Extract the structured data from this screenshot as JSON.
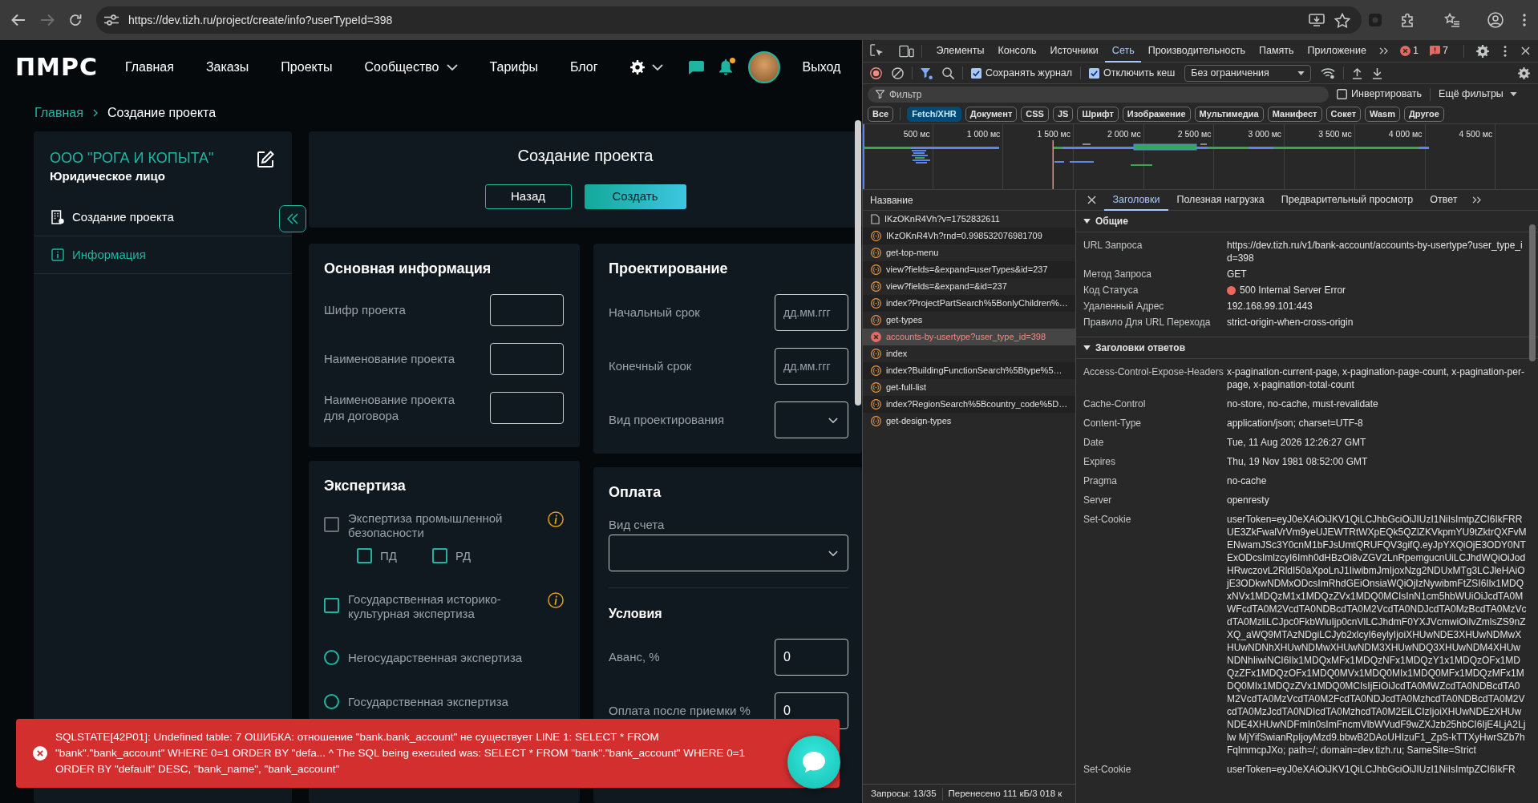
{
  "browser": {
    "url": "https://dev.tizh.ru/project/create/info?userTypeId=398"
  },
  "app": {
    "logo": "ПМРС",
    "nav": [
      {
        "label": "Главная",
        "kind": "link"
      },
      {
        "label": "Заказы",
        "kind": "link"
      },
      {
        "label": "Проекты",
        "kind": "link"
      },
      {
        "label": "Сообщество",
        "kind": "dropdown"
      },
      {
        "label": "Тарифы",
        "kind": "link"
      },
      {
        "label": "Блог",
        "kind": "link"
      }
    ],
    "has_unread_notifications": true,
    "logout": "Выход",
    "breadcrumb": [
      {
        "label": "Главная",
        "kind": "link"
      },
      {
        "label": "Создание проекта",
        "kind": "current"
      }
    ],
    "sidebar": {
      "org_name": "ООО \"РОГА И КОПЫТА\"",
      "org_type": "Юридическое лицо",
      "items": [
        {
          "label": "Создание проекта",
          "selected": false
        },
        {
          "label": "Информация",
          "selected": true
        }
      ]
    },
    "header": {
      "title": "Создание проекта",
      "buttons": [
        {
          "label": "Назад",
          "kind": "back"
        },
        {
          "label": "Создать",
          "kind": "submit"
        }
      ]
    },
    "main_info": {
      "title": "Основная информация",
      "fields": [
        {
          "label": "Шифр проекта",
          "kind": "text"
        },
        {
          "label": "Наименование проекта",
          "kind": "text"
        },
        {
          "label": "Наименование проекта для договора",
          "kind": "text"
        }
      ]
    },
    "design": {
      "title": "Проектирование",
      "fields": [
        {
          "label": "Начальный срок",
          "kind": "date",
          "placeholder": "дд.мм.ггг"
        },
        {
          "label": "Конечный срок",
          "kind": "date",
          "placeholder": "дд.мм.ггг"
        },
        {
          "label": "Вид проектирования",
          "kind": "select"
        }
      ]
    },
    "expertise": {
      "title": "Экспертиза",
      "options": [
        {
          "kind": "checkbox",
          "label": "Экспертиза промышленной безопасности",
          "checked": false,
          "disabled": true,
          "info": true,
          "children": [
            {
              "label": "ПД",
              "checked": false,
              "disabled": false
            },
            {
              "label": "РД",
              "checked": false,
              "disabled": false
            }
          ]
        },
        {
          "kind": "checkbox",
          "label": "Государственная историко-культурная экспертиза",
          "checked": false,
          "disabled": false,
          "info": true
        },
        {
          "kind": "radio",
          "label": "Негосударственная экспертиза",
          "selected": false,
          "info": false
        },
        {
          "kind": "radio",
          "label": "Государственная экспертиза",
          "selected": false,
          "info": false
        }
      ]
    },
    "payment": {
      "title": "Оплата",
      "account_label": "Вид счета",
      "terms_title": "Условия",
      "terms": [
        {
          "label": "Аванс, %",
          "value": "0"
        },
        {
          "label": "Оплата после приемки %",
          "value": "0"
        }
      ]
    },
    "toast": {
      "kind": "error",
      "message": "SQLSTATE[42P01]: Undefined table: 7 ОШИБКА: отношение \"bank.bank_account\" не существует LINE 1: SELECT * FROM \"bank\".\"bank_account\" WHERE 0=1 ORDER BY \"defa... ^ The SQL being executed was: SELECT * FROM \"bank\".\"bank_account\" WHERE 0=1 ORDER BY \"default\" DESC, \"bank_name\", \"bank_account\""
    }
  },
  "devtools": {
    "tabs": [
      {
        "label": "Элементы",
        "selected": false
      },
      {
        "label": "Консоль",
        "selected": false
      },
      {
        "label": "Источники",
        "selected": false
      },
      {
        "label": "Сеть",
        "selected": true
      },
      {
        "label": "Производительность",
        "selected": false
      },
      {
        "label": "Память",
        "selected": false
      },
      {
        "label": "Приложение",
        "selected": false
      }
    ],
    "errors": "1",
    "issues": "7",
    "recording": true,
    "preserve_log": {
      "label": "Сохранять журнал",
      "checked": true
    },
    "disable_cache": {
      "label": "Отключить кеш",
      "checked": true
    },
    "throttling": "Без ограничения",
    "filter_placeholder": "Фильтр",
    "invert": {
      "label": "Инвертировать",
      "checked": false
    },
    "more_filters": "Ещё фильтры",
    "type_filters": [
      {
        "label": "Все",
        "selected": false
      },
      {
        "label": "Fetch/XHR",
        "selected": true
      },
      {
        "label": "Документ",
        "selected": false
      },
      {
        "label": "CSS",
        "selected": false
      },
      {
        "label": "JS",
        "selected": false
      },
      {
        "label": "Шрифт",
        "selected": false
      },
      {
        "label": "Изображение",
        "selected": false
      },
      {
        "label": "Мультимедиа",
        "selected": false
      },
      {
        "label": "Манифест",
        "selected": false
      },
      {
        "label": "Сокет",
        "selected": false
      },
      {
        "label": "Wasm",
        "selected": false
      },
      {
        "label": "Другое",
        "selected": false
      }
    ],
    "overview_ticks": [
      "500 мс",
      "1 000 мс",
      "1 500 мс",
      "2 000 мс",
      "2 500 мс",
      "3 000 мс",
      "3 500 мс",
      "4 000 мс",
      "4 500 мс"
    ],
    "name_column": "Название",
    "requests": [
      {
        "name": "IKzOKnR4Vh?v=1752832611",
        "kind": "document",
        "failed": false,
        "selected": false
      },
      {
        "name": "IKzOKnR4Vh?rnd=0.998532076981709",
        "kind": "fetch",
        "failed": false,
        "selected": false
      },
      {
        "name": "get-top-menu",
        "kind": "fetch",
        "failed": false,
        "selected": false
      },
      {
        "name": "view?fields=&expand=userTypes&id=237",
        "kind": "fetch",
        "failed": false,
        "selected": false
      },
      {
        "name": "view?fields=&expand=&id=237",
        "kind": "fetch",
        "failed": false,
        "selected": false
      },
      {
        "name": "index?ProjectPartSearch%5BonlyChildren%…",
        "kind": "fetch",
        "failed": false,
        "selected": false
      },
      {
        "name": "get-types",
        "kind": "fetch",
        "failed": false,
        "selected": false
      },
      {
        "name": "accounts-by-usertype?user_type_id=398",
        "kind": "fetch",
        "failed": true,
        "selected": true
      },
      {
        "name": "index",
        "kind": "fetch",
        "failed": false,
        "selected": false
      },
      {
        "name": "index?BuildingFunctionSearch%5Btype%5…",
        "kind": "fetch",
        "failed": false,
        "selected": false
      },
      {
        "name": "get-full-list",
        "kind": "fetch",
        "failed": false,
        "selected": false
      },
      {
        "name": "index?RegionSearch%5Bcountry_code%5D…",
        "kind": "fetch",
        "failed": false,
        "selected": false
      },
      {
        "name": "get-design-types",
        "kind": "fetch",
        "failed": false,
        "selected": false
      }
    ],
    "summary": {
      "requests": "Запросы: 13/35",
      "transferred": "Перенесено 111 кБ/3 018 к"
    },
    "detail_tabs": [
      {
        "label": "Заголовки",
        "selected": true
      },
      {
        "label": "Полезная нагрузка",
        "selected": false
      },
      {
        "label": "Предварительный просмотр",
        "selected": false
      },
      {
        "label": "Ответ",
        "selected": false
      }
    ],
    "sections": [
      {
        "title": "Общие",
        "expanded": true,
        "rows": [
          {
            "name": "URL Запроса",
            "value": "https://dev.tizh.ru/v1/bank-account/accounts-by-usertype?user_type_id=398"
          },
          {
            "name": "Метод Запроса",
            "value": "GET"
          },
          {
            "name": "Код Статуса",
            "value": "500 Internal Server Error",
            "color": "#ee675c"
          },
          {
            "name": "Удаленный Адрес",
            "value": "192.168.99.101:443"
          },
          {
            "name": "Правило Для URL Перехода",
            "value": "strict-origin-when-cross-origin"
          }
        ]
      },
      {
        "title": "Заголовки ответов",
        "expanded": true,
        "rows": [
          {
            "name": "Access-Control-Expose-Headers",
            "value": "x-pagination-current-page, x-pagination-page-count, x-pagination-per-page, x-pagination-total-count"
          },
          {
            "name": "Cache-Control",
            "value": "no-store, no-cache, must-revalidate"
          },
          {
            "name": "Content-Type",
            "value": "application/json; charset=UTF-8"
          },
          {
            "name": "Date",
            "value": "Tue, 11 Aug 2026 12:26:27 GMT"
          },
          {
            "name": "Expires",
            "value": "Thu, 19 Nov 1981 08:52:00 GMT"
          },
          {
            "name": "Pragma",
            "value": "no-cache"
          },
          {
            "name": "Server",
            "value": "openresty"
          },
          {
            "name": "Set-Cookie",
            "value": "userToken=eyJ0eXAiOiJKV1QiLCJhbGciOiJIUzI1NiIsImtpZCI6IkFRRUE3ZkFwalVrVm9yeUJEWTRtWXpEQk5QZlZKVkpmYU9tZktrQXFvMENwamJSc3Y0cnM1bFJsUmtQRUFQV3gifQ.eyJpYXQiOjE3ODY0NTExODcsImlzcyI6Imh0dHBzOi8vZGV2LnRpemgucnUiLCJhdWQiOiJodHRwczovL2RldI50aXpoLnJ1IiwibmJmIjoxNzg2NDUxMTg3LCJleHAiOjE3ODkwNDMxODcsImRhdGEiOnsiaWQiOjIzNywibmFtZSI6Ilx1MDQxNVx1MDQzM1x1MDQzZVx1MDQ0MCIsInN1cm5hbWUiOiJcdTA0MWFcdTA0M2VcdTA0NDBcdTA0M2VcdTA0NDJcdTA0MzBcdTA0MzVcdTA0MzliLCJpc0FkbWluIjp0cnVlLCJhdmF0YXJVcmwiOiIvZmlsZS9nZXQ_aWQ9MTAzNDgiLCJyb2xlcyI6eylyIjoiXHUwNDE3XHUwNDMwXHUwNDNhXHUwNDMwXHUwNDM3XHUwNDQ3XHUwNDM4XHUwNDNhIiwiNCI6Ilx1MDQxMFx1MDQzNFx1MDQzY1x1MDQzOFx1MDQzZFx1MDQzOFx1MDQ0MVx1MDQ0MIx1MDQ0MFx1MDQzMFx1MDQ0MIx1MDQzZVx1MDQ0MCIsIjEiOiJcdTA0MWZcdTA0NDBcdTA0M2VcdTA0MzVcdTA0M2FcdTA0NDJcdTA0MzhcdTA0NDBcdTA0M2VcdTA0MzJcdTA0NDIcdTA0MzhcdTA0M2EiLCIzIjoiXHUwNDEzXHUwNDE4XHUwNDFmIn0sImFncmVlbWVudF9wZXJzb25hbCI6IjE4LjA2Ljlw MjYifSwianRpIjoyMzd9.bbwB2DAoUHIzuF1_ZpS-kTTXyHwrSZb7hFqlmmcpJXo; path=/; domain=dev.tizh.ru; SameSite=Strict"
          },
          {
            "name": "Set-Cookie",
            "value": "userToken=eyJ0eXAiOiJKV1QiLCJhbGciOiJIUzI1NiIsImtpZCI6IkFR"
          }
        ]
      }
    ]
  }
}
